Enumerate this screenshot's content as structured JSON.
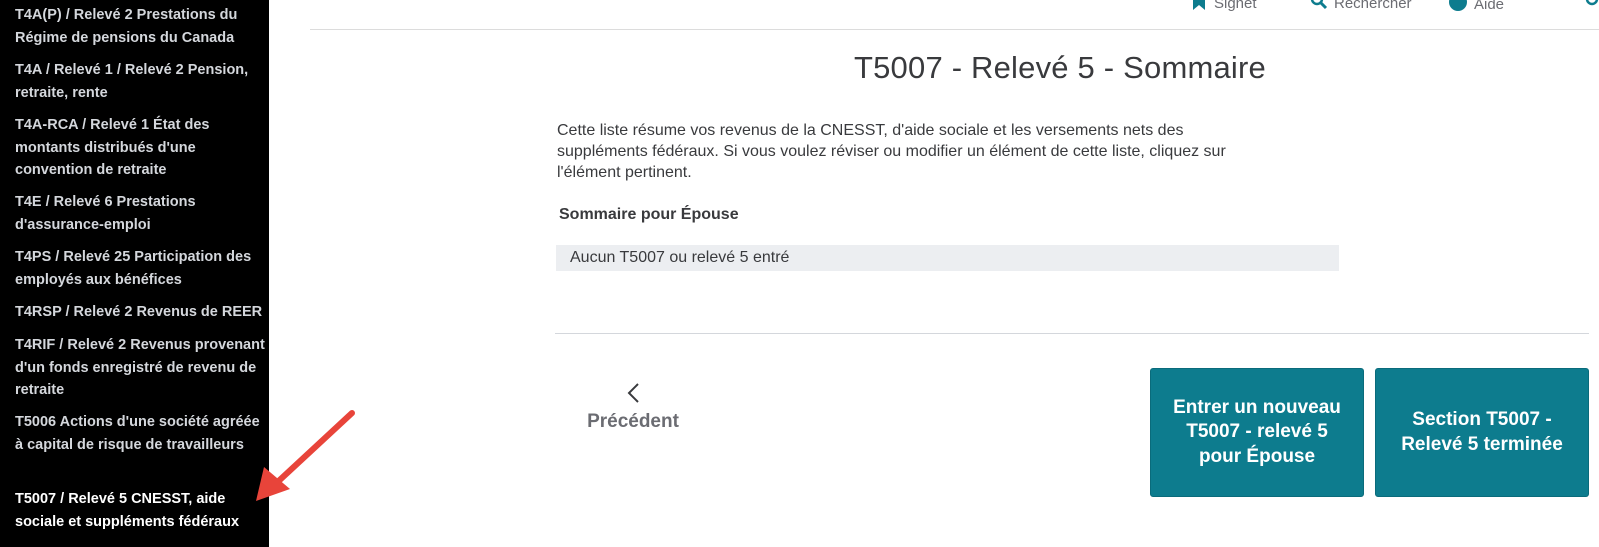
{
  "sidebar": {
    "items": [
      {
        "label": "T4A(P) / Relevé 2 Prestations du Régime de pensions du Canada"
      },
      {
        "label": "T4A / Relevé 1 / Relevé 2 Pension, retraite, rente"
      },
      {
        "label": "T4A-RCA / Relevé 1 État des montants distribués d'une convention de retraite"
      },
      {
        "label": "T4E / Relevé 6 Prestations d'assurance-emploi"
      },
      {
        "label": "T4PS / Relevé 25 Participation des employés aux bénéfices"
      },
      {
        "label": "T4RSP / Relevé 2 Revenus de REER"
      },
      {
        "label": "T4RIF / Relevé 2 Revenus provenant d'un fonds enregistré de revenu de retraite"
      },
      {
        "label": "T5006 Actions d'une société agréée à capital de risque de travailleurs"
      },
      {
        "label": "T5007 / Relevé 5 CNESST, aide sociale et suppléments fédéraux"
      }
    ]
  },
  "toolbar": {
    "bookmark_label": "Signet",
    "search_label": "Rechercher",
    "help_label": "Aide"
  },
  "main": {
    "title": "T5007 - Relevé 5 - Sommaire",
    "description": "Cette liste résume vos revenus de la CNESST, d'aide sociale et les versements nets des suppléments fédéraux. Si vous voulez réviser ou modifier un élément de cette liste, cliquez sur l'élément pertinent.",
    "summary_label": "Sommaire pour Épouse",
    "summary_empty": "Aucun T5007 ou relevé 5 entré"
  },
  "nav": {
    "previous_label": "Précédent",
    "new_entry_label": "Entrer un nouveau T5007 - relevé 5 pour Épouse",
    "done_label": "Section T5007 - Relevé 5 terminée"
  },
  "colors": {
    "sidebar_bg": "#000000",
    "button_bg": "#0d7c8e",
    "annotation_arrow": "#e8443a"
  }
}
